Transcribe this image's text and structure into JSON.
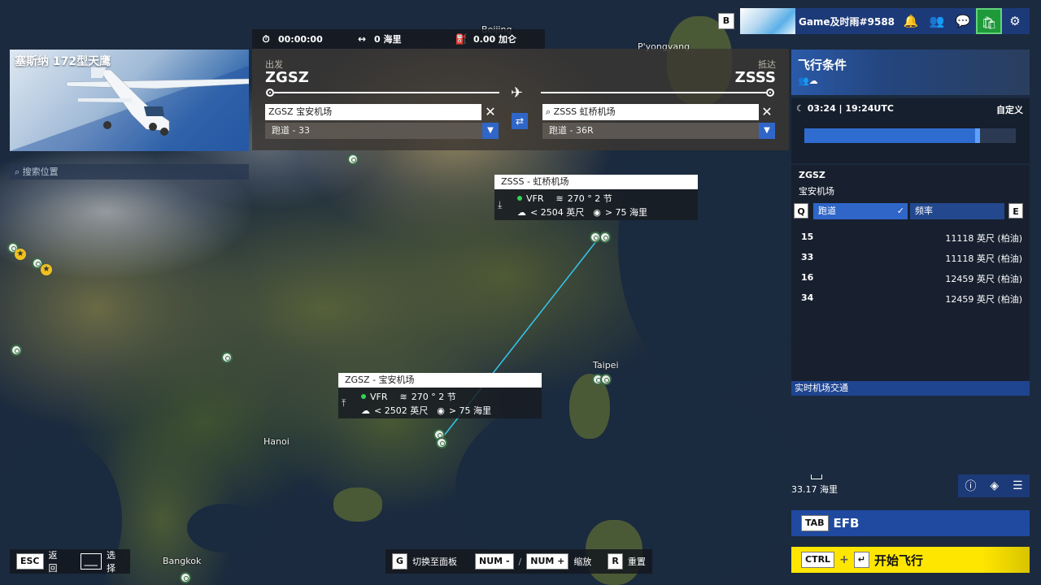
{
  "stats": {
    "time": "00:00:00",
    "distance": "0 海里",
    "fuel": "0.00 加仑"
  },
  "aircraft": {
    "name": "塞斯纳 172型天鹰"
  },
  "search": {
    "placeholder": "搜索位置"
  },
  "route": {
    "departure": {
      "label": "出发",
      "code": "ZGSZ",
      "airport": "ZGSZ 宝安机场",
      "runway": "跑道 - 33"
    },
    "arrival": {
      "label": "抵达",
      "code": "ZSSS",
      "airport": "ZSSS 虹桥机场",
      "runway": "跑道 - 36R"
    }
  },
  "callouts": {
    "arrival": {
      "title": "ZSSS - 虹桥机场",
      "rules": "VFR",
      "wind": "270 ° 2 节",
      "ceiling": "< 2504  英尺",
      "visibility": "> 75  海里"
    },
    "departure": {
      "title": "ZGSZ - 宝安机场",
      "rules": "VFR",
      "wind": "270 ° 2 节",
      "ceiling": "< 2502  英尺",
      "visibility": "> 75  海里"
    }
  },
  "map": {
    "cities": [
      "Beijing",
      "P'yongyang",
      "Taipei",
      "Hanoi",
      "Bangkok"
    ]
  },
  "header": {
    "b_key": "B",
    "gamertag": "Game及时雨#9588"
  },
  "conditions": {
    "title": "飞行条件",
    "time": "03:24 | 19:24UTC",
    "preset": "自定义",
    "time_of_day_fraction": 0.82
  },
  "airport_info": {
    "code": "ZGSZ",
    "name": "宝安机场",
    "key_left": "Q",
    "key_right": "E",
    "tabs": [
      "跑道",
      "频率"
    ],
    "runways": [
      {
        "id": "15",
        "length": "11118  英尺 (柏油)"
      },
      {
        "id": "33",
        "length": "11118  英尺 (柏油)"
      },
      {
        "id": "16",
        "length": "12459  英尺 (柏油)"
      },
      {
        "id": "34",
        "length": "12459  英尺 (柏油)"
      }
    ],
    "traffic_label": "实时机场交通"
  },
  "scale": {
    "value": "33.17  海里"
  },
  "efb": {
    "key": "TAB",
    "label": "EFB"
  },
  "fly": {
    "key": "CTRL",
    "plus": "+",
    "enter_key": "↵",
    "label": "开始飞行"
  },
  "bottom": {
    "esc_key": "ESC",
    "back": "返回",
    "select_key": "___",
    "select": "选择",
    "g_key": "G",
    "switch_panel": "切换至面板",
    "num_minus": "NUM -",
    "slash": "/",
    "num_plus": "NUM +",
    "zoom": "缩放",
    "r_key": "R",
    "reset": "重置"
  },
  "colors": {
    "accent_blue": "#2f66c8",
    "fly_yellow": "#ffe600",
    "route_line": "#35c6ee"
  }
}
